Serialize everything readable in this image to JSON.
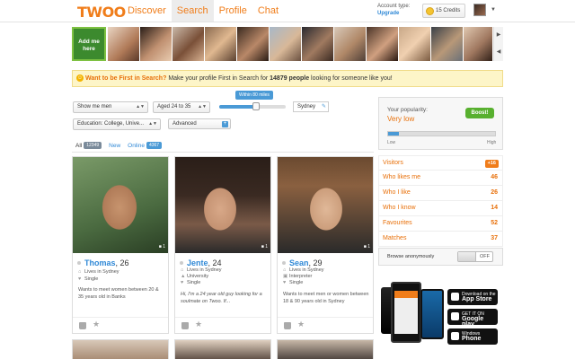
{
  "header": {
    "logo": "TWOO",
    "nav": [
      {
        "label": "Discover",
        "active": false
      },
      {
        "label": "Search",
        "active": true
      },
      {
        "label": "Profile",
        "active": false
      },
      {
        "label": "Chat",
        "active": false
      }
    ],
    "account_label": "Account type:",
    "account_action": "Upgrade",
    "credits": "15 Credits"
  },
  "strip": {
    "add_me": "Add me here"
  },
  "banner": {
    "highlight": "Want to be First in Search?",
    "text_before": " Make your profile First in Search for ",
    "count": "14879 people",
    "text_after": " looking for someone like you!"
  },
  "filters": {
    "gender": "Show me men",
    "age": "Aged 24 to 35",
    "distance": "Within 80 miles",
    "distance_fraction": 0.55,
    "city": "Sydney",
    "education": "Education: College, Unive...",
    "advanced": "Advanced"
  },
  "tabs": [
    {
      "label": "All",
      "count": "12349",
      "active": true
    },
    {
      "label": "New",
      "count": "",
      "active": false
    },
    {
      "label": "Online",
      "count": "4367",
      "active": false
    }
  ],
  "cards": [
    {
      "name": "Thomas",
      "age": ", 26",
      "photos": "1",
      "line1": "Lives in Sydney",
      "line2": "Single",
      "desc": "Wants to meet women between 20 & 35 years old in Banks",
      "italic": false
    },
    {
      "name": "Jente",
      "age": ", 24",
      "photos": "1",
      "line1": "Lives in Sydney",
      "line2": "University",
      "line3": "Single",
      "desc": "Hi, I'm a 24 year old guy looking for a soulmate on Twoo. If...",
      "italic": true
    },
    {
      "name": "Sean",
      "age": ", 29",
      "photos": "1",
      "line1": "Lives in Sydney",
      "line2": "Interpreter",
      "line3": "Single",
      "desc": "Wants to meet men or women between 18 & 90 years old in Sydney",
      "italic": false
    }
  ],
  "popularity": {
    "label": "Your popularity:",
    "value": "Very low",
    "boost": "Boost!",
    "level": 0.1,
    "low": "Low",
    "high": "High"
  },
  "stats": [
    {
      "label": "Visitors",
      "value": "+16",
      "badge": true
    },
    {
      "label": "Who likes me",
      "value": "46",
      "badge": false
    },
    {
      "label": "Who I like",
      "value": "26",
      "badge": false
    },
    {
      "label": "Who I know",
      "value": "14",
      "badge": false
    },
    {
      "label": "Favourites",
      "value": "52",
      "badge": false
    },
    {
      "label": "Matches",
      "value": "37",
      "badge": false
    }
  ],
  "anon": {
    "label": "Browse anonymously",
    "state": "OFF"
  },
  "stores": [
    {
      "small": "Download on the",
      "big": "App Store"
    },
    {
      "small": "GET IT ON",
      "big": "Google play"
    },
    {
      "small": "Windows",
      "big": "Phone"
    }
  ]
}
